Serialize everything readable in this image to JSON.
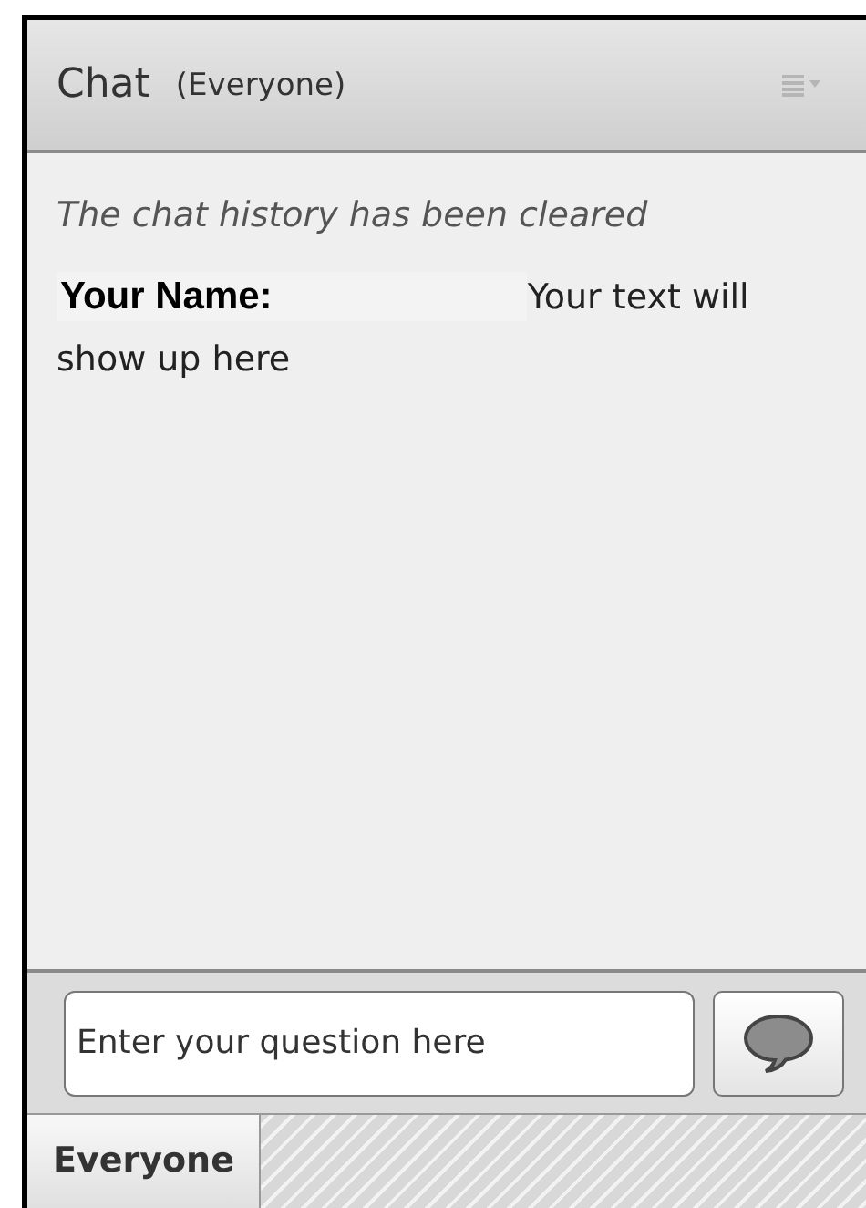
{
  "header": {
    "title": "Chat",
    "audience": "(Everyone)"
  },
  "messages": [
    {
      "kind": "system",
      "text": "The chat history has been cleared"
    },
    {
      "kind": "user",
      "sender": "Your Name:",
      "text": "Your text will show up here"
    }
  ],
  "composer": {
    "placeholder": "Enter your question here"
  },
  "tabs": [
    {
      "label": "Everyone",
      "selected": true
    }
  ]
}
